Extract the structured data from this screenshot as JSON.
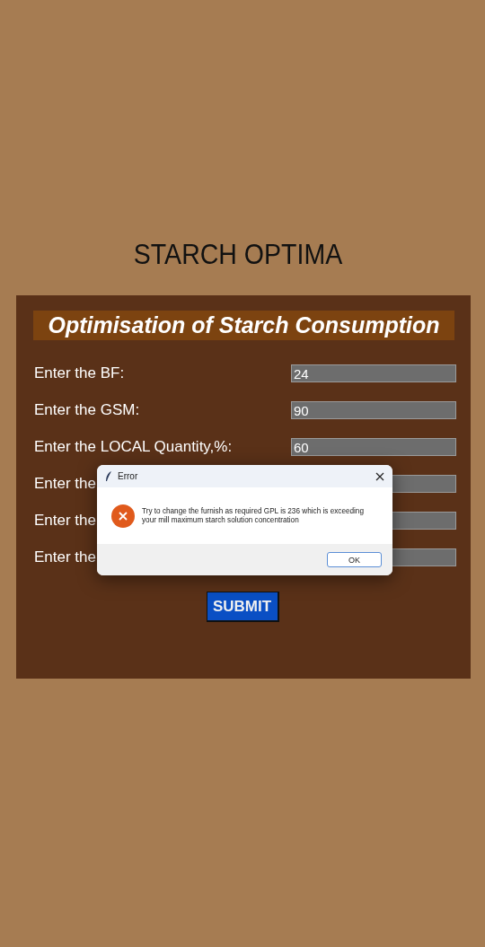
{
  "app_title": "STARCH OPTIMA",
  "form": {
    "heading": "Optimisation of Starch Consumption",
    "fields": [
      {
        "label": "Enter the BF:",
        "value": "24"
      },
      {
        "label": "Enter the GSM:",
        "value": "90"
      },
      {
        "label": "Enter the LOCAL Quantity,%:",
        "value": "60"
      },
      {
        "label": "Enter the"
      },
      {
        "label": "Enter the"
      },
      {
        "label": "Enter the"
      }
    ],
    "submit": "SUBMIT"
  },
  "dialog": {
    "title": "Error",
    "message": "Try to change the furnish as required GPL is 236 which is exceeding your mill maximum starch solution concentration",
    "button": "OK"
  }
}
